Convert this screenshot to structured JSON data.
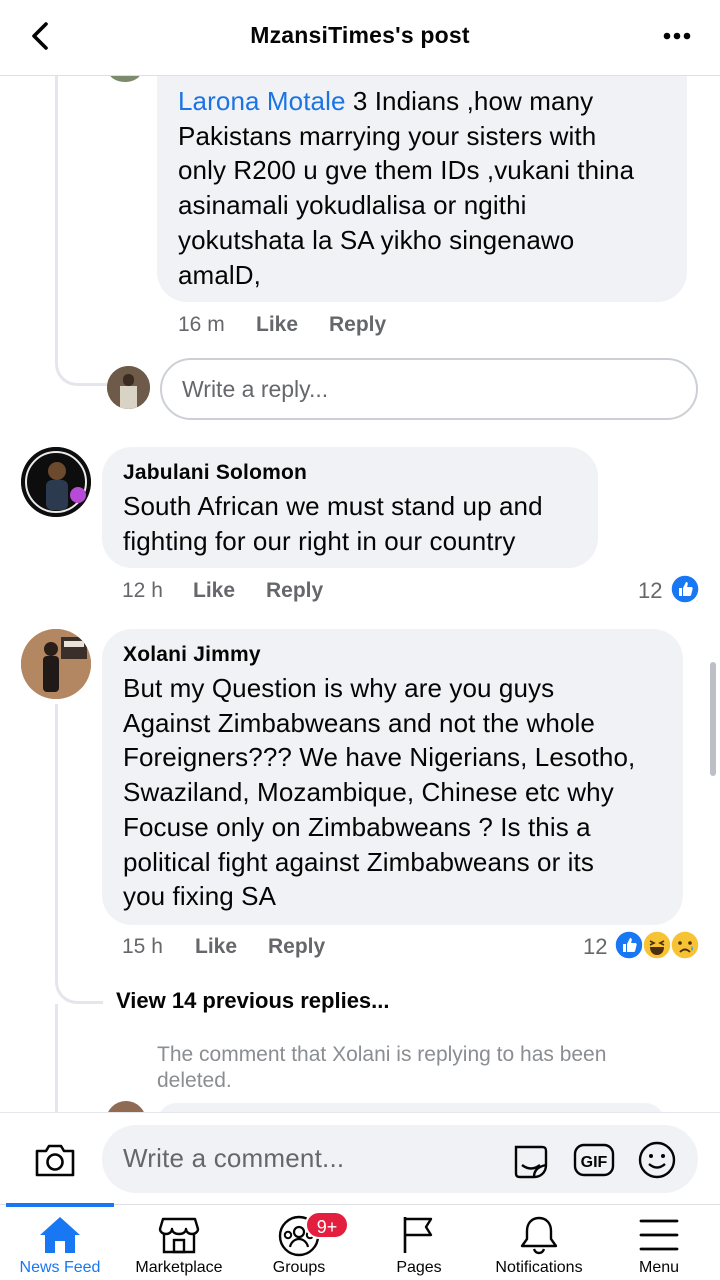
{
  "header": {
    "title": "MzansiTimes's post"
  },
  "comments": [
    {
      "mention": "Larona Motale",
      "lines": [
        " 3 Indians ,how many",
        "Pakistans marrying your sisters with",
        "only R200 u gve them IDs ,vukani thina",
        "asinamali yokudlalisa or ngithi",
        "yokutshata la SA yikho singenawo",
        "amalD,"
      ],
      "time": "16 m",
      "like": "Like",
      "reply": "Reply"
    },
    {
      "author": "Jabulani Solomon",
      "lines": [
        "South African we must stand up and",
        "fighting for our right in our country"
      ],
      "time": "12 h",
      "like": "Like",
      "reply": "Reply",
      "reactions": "12"
    },
    {
      "author": "Xolani Jimmy",
      "lines": [
        "But my Question is why are you guys",
        "Against Zimbabweans and not the whole",
        "Foreigners??? We have Nigerians, Lesotho,",
        "Swaziland, Mozambique, Chinese etc why",
        "Focuse only on Zimbabweans ? Is this a",
        "political fight against Zimbabweans or its",
        "you fixing SA"
      ],
      "time": "15 h",
      "like": "Like",
      "reply": "Reply",
      "reactions": "12"
    }
  ],
  "reply_input": {
    "placeholder": "Write a reply..."
  },
  "view_previous": "View 14 previous replies...",
  "deleted_note": "The comment that Xolani is replying to has been deleted.",
  "composer": {
    "placeholder": "Write a comment...",
    "gif_label": "GIF"
  },
  "tabs": [
    {
      "label": "News Feed",
      "icon": "home-icon",
      "active": true
    },
    {
      "label": "Marketplace",
      "icon": "marketplace-icon"
    },
    {
      "label": "Groups",
      "icon": "groups-icon",
      "badge": "9+"
    },
    {
      "label": "Pages",
      "icon": "flag-icon"
    },
    {
      "label": "Notifications",
      "icon": "bell-icon"
    },
    {
      "label": "Menu",
      "icon": "menu-icon"
    }
  ],
  "colors": {
    "accent": "#1877f2",
    "badge": "#e41e3f",
    "bubble": "#f0f2f5",
    "secondary_text": "#65676b"
  }
}
